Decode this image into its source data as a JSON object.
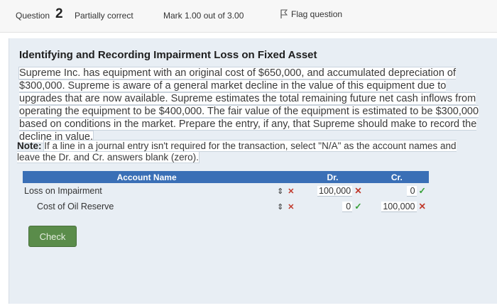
{
  "header": {
    "question_label": "Question",
    "question_number": "2",
    "status": "Partially correct",
    "mark": "Mark 1.00 out of 3.00",
    "flag_label": "Flag question"
  },
  "problem": {
    "title": "Identifying and Recording Impairment Loss on Fixed Asset",
    "body": "Supreme Inc. has equipment with an original cost of $650,000, and accumulated depreciation of $300,000. Supreme is aware of a general market decline in the value of this equipment due to upgrades that are now available. Supreme estimates the total remaining future net cash inflows from operating the equipment to be $400,000. The fair value of the equipment is estimated to be $300,000 based on conditions in the market. Prepare the entry, if any, that Supreme should make to record the decline in value.",
    "note_label": "Note:",
    "note_text": "If a line in a journal entry isn't required for the transaction, select \"N/A\" as the account names and leave the Dr. and Cr. answers blank (zero)."
  },
  "journal": {
    "headers": {
      "account": "Account Name",
      "dr": "Dr.",
      "cr": "Cr."
    },
    "rows": [
      {
        "account": "Loss on Impairment",
        "account_mark": "x",
        "dr": "100,000",
        "dr_mark": "x",
        "cr": "0",
        "cr_mark": "check"
      },
      {
        "account": "Cost of Oil Reserve",
        "account_mark": "x",
        "dr": "0",
        "dr_mark": "check",
        "cr": "100,000",
        "cr_mark": "x"
      }
    ]
  },
  "actions": {
    "check_label": "Check"
  },
  "colors": {
    "table_header": "#3a6fb6",
    "incorrect": "#c0392b",
    "correct": "#3aa13a",
    "check_button": "#5a8c4a"
  }
}
